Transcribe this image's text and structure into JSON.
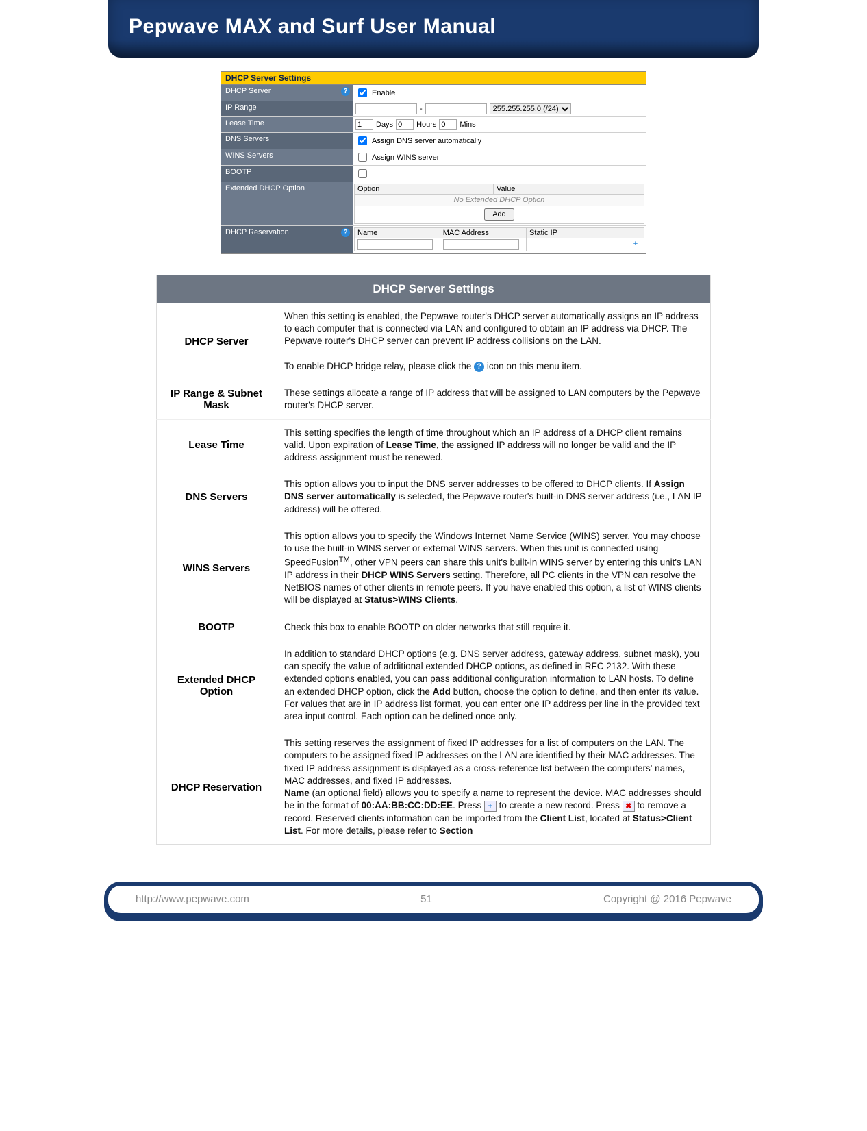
{
  "header": {
    "title": "Pepwave MAX and Surf User Manual"
  },
  "ui": {
    "panel_title": "DHCP Server Settings",
    "rows": {
      "dhcp_server": {
        "label": "DHCP Server",
        "enable": "Enable"
      },
      "ip_range": {
        "label": "IP Range",
        "dash": "-",
        "mask": "255.255.255.0 (/24)"
      },
      "lease_time": {
        "label": "Lease Time",
        "days_val": "1",
        "days": "Days",
        "hours_val": "0",
        "hours": "Hours",
        "mins_val": "0",
        "mins": "Mins"
      },
      "dns": {
        "label": "DNS Servers",
        "text": "Assign DNS server automatically"
      },
      "wins": {
        "label": "WINS Servers",
        "text": "Assign WINS server"
      },
      "bootp": {
        "label": "BOOTP"
      },
      "ext": {
        "label": "Extended DHCP Option",
        "col_option": "Option",
        "col_value": "Value",
        "empty": "No Extended DHCP Option",
        "add": "Add"
      },
      "resv": {
        "label": "DHCP Reservation",
        "col_name": "Name",
        "col_mac": "MAC Address",
        "col_ip": "Static IP",
        "plus": "+"
      }
    }
  },
  "desc": {
    "title": "DHCP Server Settings",
    "dhcp_server": {
      "label": "DHCP Server",
      "p1": "When this setting is enabled, the Pepwave router's DHCP server automatically assigns an IP address to each computer that is connected via LAN and configured to obtain an IP address via DHCP. The Pepwave router's DHCP server can prevent IP address collisions on the LAN.",
      "p2a": "To enable DHCP bridge relay, please click the ",
      "p2b": " icon on this menu item."
    },
    "ip_range": {
      "label": "IP Range & Subnet Mask",
      "body": "These settings allocate a range of IP address that will be assigned to LAN computers by the Pepwave router's DHCP server."
    },
    "lease": {
      "label": "Lease Time",
      "pre": "This setting specifies the length of time throughout which an IP address of a DHCP client remains valid. Upon expiration of ",
      "bold": "Lease Time",
      "post": ", the assigned IP address will no longer be valid and the IP address assignment must be renewed."
    },
    "dns": {
      "label": "DNS Servers",
      "pre": "This option allows you to input the DNS server addresses to be offered to DHCP clients. If ",
      "bold": "Assign DNS server automatically",
      "post": " is selected, the Pepwave router's built-in DNS server address (i.e., LAN IP address) will be offered."
    },
    "wins": {
      "label": "WINS Servers",
      "pre": "This option allows you to specify the Windows Internet Name Service (WINS) server. You may choose to use the built-in WINS server or external WINS servers. When this unit is connected using SpeedFusion",
      "tm": "TM",
      "mid": ", other VPN peers can share this unit's built-in WINS server by entering this unit's LAN IP address in their ",
      "bold1": "DHCP WINS Servers",
      "mid2": " setting. Therefore, all PC clients in the VPN can resolve the NetBIOS names of other clients in remote peers. If you have enabled this option, a list of WINS clients will be displayed at ",
      "bold2": "Status>WINS Clients",
      "post": "."
    },
    "bootp": {
      "label": "BOOTP",
      "body": "Check this box to enable BOOTP on older networks that still require it."
    },
    "ext": {
      "label": "Extended DHCP Option",
      "pre": "In addition to standard DHCP options (e.g. DNS server address, gateway address, subnet mask), you can specify the value of additional extended DHCP options, as defined in RFC 2132. With these extended options enabled, you can pass additional configuration information to LAN hosts. To define an extended DHCP option, click the ",
      "bold": "Add",
      "post": " button, choose the option to define, and then enter its value. For values that are in IP address list format, you can enter one IP address per line in the provided text area input control. Each option can be defined once only."
    },
    "resv": {
      "label": "DHCP Reservation",
      "p1": "This setting reserves the assignment of fixed IP addresses for a list of computers on the LAN. The computers to be assigned fixed IP addresses on the LAN are identified by their MAC addresses. The fixed IP address assignment is displayed as a cross-reference list between the computers' names, MAC addresses, and fixed IP addresses.",
      "name_bold": "Name",
      "name_post": " (an optional field) allows you to specify a name to represent the device. MAC addresses should be in the format of ",
      "mac_bold": "00:AA:BB:CC:DD:EE",
      "press1": ". Press ",
      "press2": " to create a new record. Press ",
      "press3": " to remove a record. Reserved clients information can be imported from the ",
      "client_list": "Client List",
      "loc": ", located at ",
      "status_cl": "Status>Client List",
      "tail": ". For more details, please refer to ",
      "section": "Section"
    }
  },
  "footer": {
    "url": "http://www.pepwave.com",
    "page": "51",
    "copyright": "Copyright @ 2016 Pepwave"
  }
}
